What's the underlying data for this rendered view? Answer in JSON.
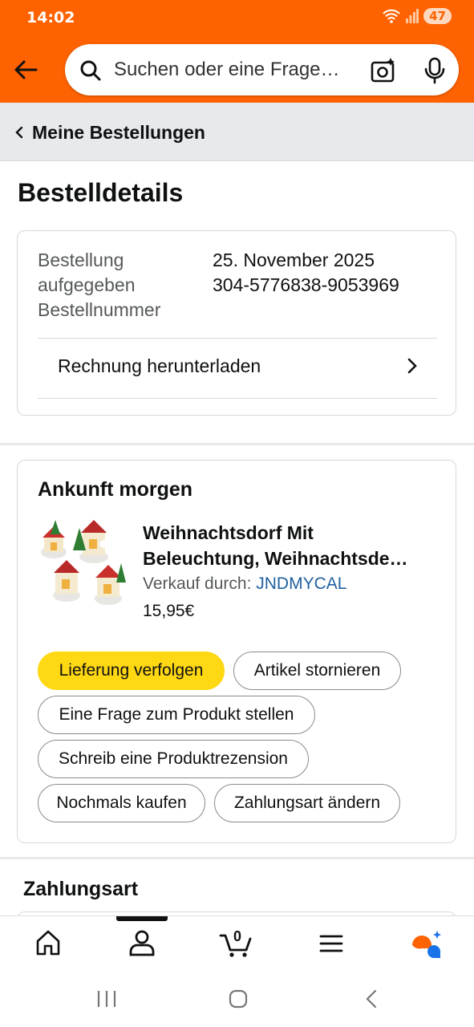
{
  "status": {
    "time": "14:02",
    "battery": "47"
  },
  "search": {
    "placeholder": "Suchen oder eine Frage…"
  },
  "breadcrumb": {
    "label": "Meine Bestellungen"
  },
  "page": {
    "title": "Bestelldetails"
  },
  "order": {
    "placed_label": "Bestellung aufgegeben",
    "placed_value": "25. November 2025",
    "number_label": "Bestellnummer",
    "number_value": "304-5776838-9053969",
    "invoice_label": "Rechnung herunterladen"
  },
  "shipment": {
    "status": "Ankunft morgen",
    "product_title": "Weihnachtsdorf Mit Beleuchtung, Weihnachtsde…",
    "seller_prefix": "Verkauf durch:",
    "seller_name": "JNDMYCAL",
    "price": "15,95€",
    "buttons": {
      "track": "Lieferung verfolgen",
      "cancel": "Artikel stornieren",
      "question": "Eine Frage zum Produkt stellen",
      "review": "Schreib eine Produktrezension",
      "buy_again": "Nochmals kaufen",
      "change_payment": "Zahlungsart ändern"
    }
  },
  "payment": {
    "title": "Zahlungsart"
  },
  "bottom_nav": {
    "cart_count": "0"
  },
  "colors": {
    "brand": "#ff6200",
    "primary_button": "#ffd814",
    "link": "#2162a1"
  }
}
